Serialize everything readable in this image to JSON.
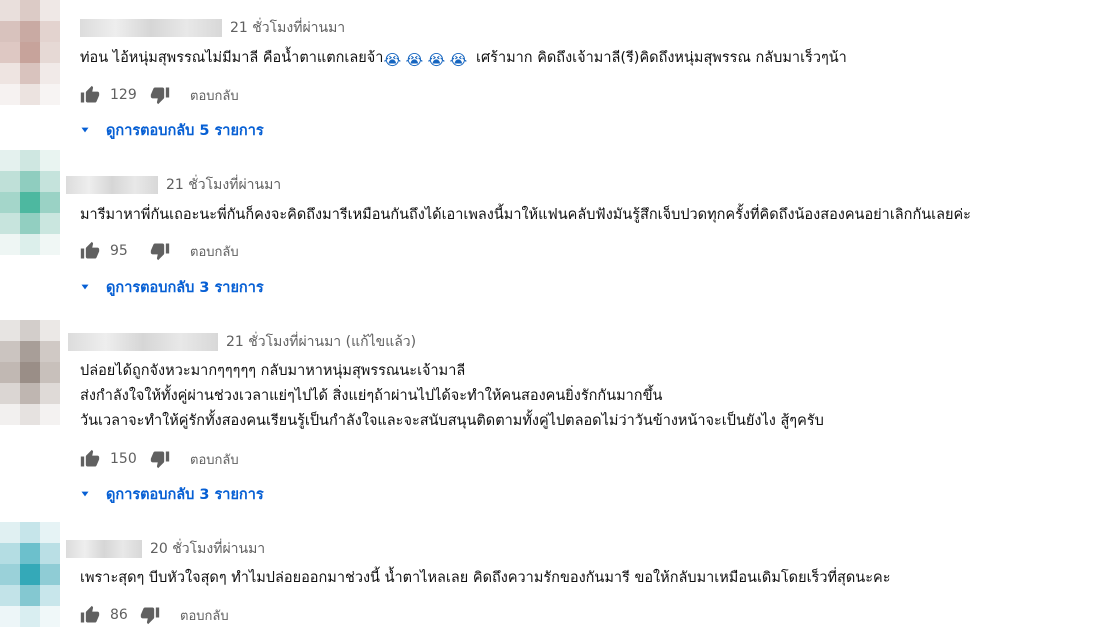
{
  "ui": {
    "reply_label": "ตอบกลับ",
    "accent_color": "#065fd4",
    "meta_color": "#606060",
    "icons": [
      "thumb-up-icon",
      "thumb-down-icon",
      "caret-down-icon",
      "loudly-crying-face-emoji"
    ]
  },
  "comments": [
    {
      "time": "21 ชั่วโมงที่ผ่านมา",
      "text_before_emoji": "ท่อน ไอ้หนุ่มสุพรรณไม่มีมาลี คือน้ำตาแตกเลยจ้า",
      "emoji": "😭",
      "text_after_emoji": "เศร้ามาก คิดถึงเจ้ามาลี(รี)คิดถึงหนุ่มสุพรรณ กลับมาเร็วๆน้า",
      "likes": "129",
      "view_replies": "ดูการตอบกลับ 5 รายการ"
    },
    {
      "time": "21 ชั่วโมงที่ผ่านมา",
      "text": "มารีมาหาพี่กันเถอะนะพี่กันก็คงจะคิดถึงมารีเหมือนกันถึงได้เอาเพลงนี้มาให้แฟนคลับฟังมันรู้สึกเจ็บปวดทุกครั้งที่คิดถึงน้องสองคนอย่าเลิกกันเลยค่ะ",
      "likes": "95",
      "view_replies": "ดูการตอบกลับ 3 รายการ"
    },
    {
      "time": "21 ชั่วโมงที่ผ่านมา (แก้ไขแล้ว)",
      "lines": [
        "ปล่อยได้ถูกจังหวะมากๆๆๆๆๆ กลับมาหาหนุ่มสุพรรณนะเจ้ามาลี",
        "ส่งกำลังใจให้ทั้งคู่ผ่านช่วงเวลาแย่ๆไปได้ สิ่งแย่ๆถ้าผ่านไปได้จะทำให้คนสองคนยิ่งรักกันมากขึ้น",
        "วันเวลาจะทำให้คู่รักทั้งสองคนเรียนรู้เป็นกำลังใจและจะสนับสนุนติดตามทั้งคู่ไปตลอดไม่ว่าวันข้างหน้าจะเป็นยังไง สู้ๆครับ"
      ],
      "likes": "150",
      "view_replies": "ดูการตอบกลับ 3 รายการ"
    },
    {
      "time": "20 ชั่วโมงที่ผ่านมา",
      "text": "เพราะสุดๆ บีบหัวใจสุดๆ ทำไมปล่อยออกมาช่วงนี้ น้ำตาไหลเลย คิดถึงความรักของกันมารี ขอให้กลับมาเหมือนเดิมโดยเร็วที่สุดนะคะ",
      "likes": "86"
    }
  ]
}
